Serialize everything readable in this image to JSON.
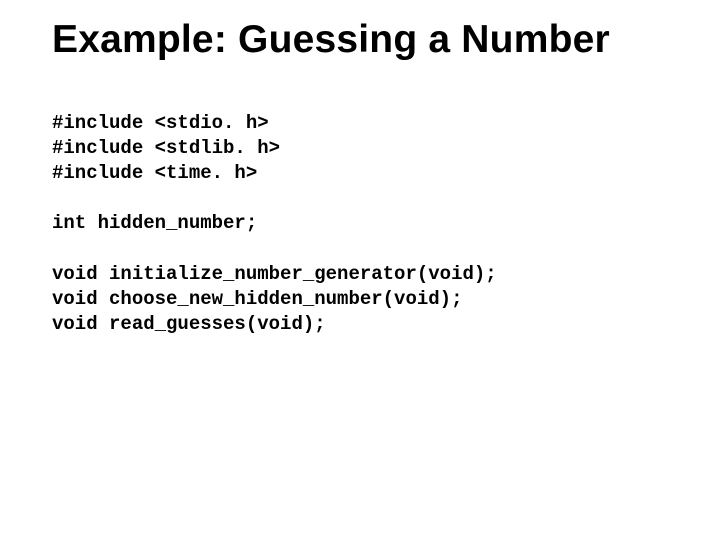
{
  "title": "Example: Guessing a Number",
  "code": {
    "l1": "#include <stdio. h>",
    "l2": "#include <stdlib. h>",
    "l3": "#include <time. h>",
    "l4": "int hidden_number;",
    "l5": "void initialize_number_generator(void);",
    "l6": "void choose_new_hidden_number(void);",
    "l7": "void read_guesses(void);"
  }
}
